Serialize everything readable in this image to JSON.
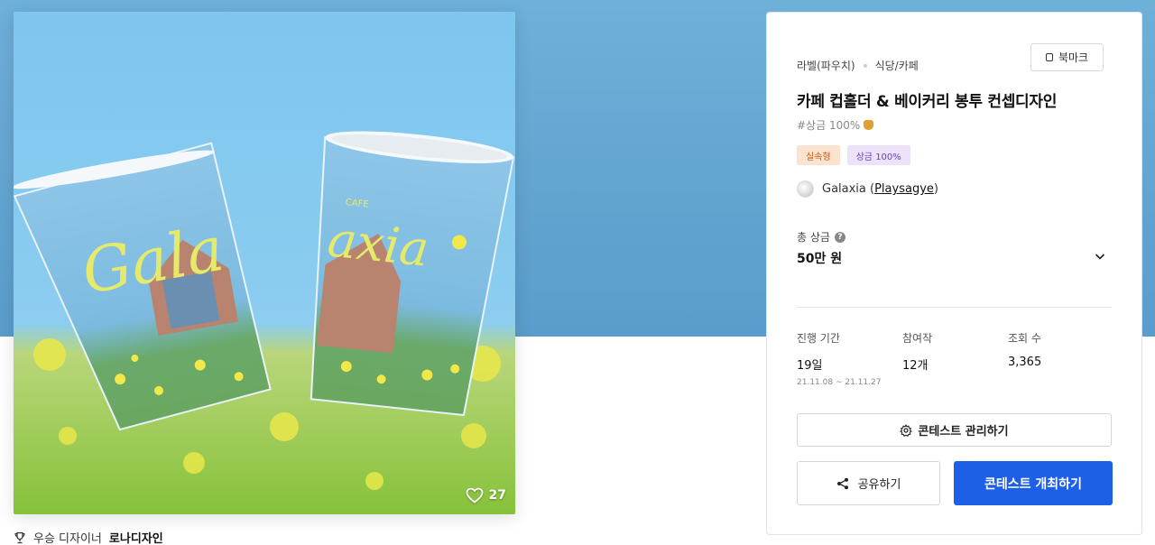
{
  "artwork": {
    "cup_text": "Galaxia",
    "cup_small_text": "CAFE",
    "likes": "27"
  },
  "winner": {
    "label": "우승 디자이너",
    "name": "로나디자인"
  },
  "card": {
    "category": "라벨(파우치)",
    "industry": "식당/카페",
    "bookmark_label": "북마크",
    "title": "카페 컵홀더 & 베이커리 봉투 컨셉디자인",
    "hashtag": "#상금 100%",
    "badges": [
      "실속형",
      "상금 100%"
    ],
    "host_name": "Galaxia (",
    "host_id": "Playsagye",
    "host_close": ")",
    "prize_label": "총 상금",
    "prize_value": "50만 원",
    "stats": {
      "period_label": "진행 기간",
      "period_value": "19일",
      "period_range": "21.11.08 ~ 21.11.27",
      "entries_label": "참여작",
      "entries_value": "12개",
      "views_label": "조회 수",
      "views_value": "3,365"
    },
    "manage_label": "콘테스트 관리하기",
    "share_label": "공유하기",
    "host_contest_label": "콘테스트 개최하기"
  },
  "colors": {
    "primary": "#1e5fe8",
    "sky": "#6eb0d8"
  }
}
